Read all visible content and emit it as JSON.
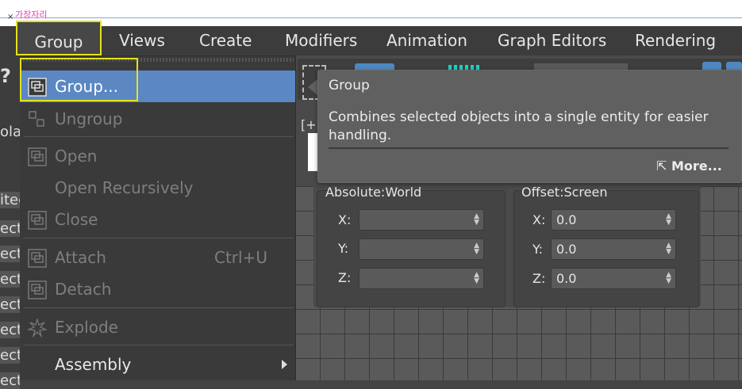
{
  "annotation": {
    "korean_label": "가장자리",
    "close_mark": "×"
  },
  "menubar": {
    "items": [
      {
        "label": "Group"
      },
      {
        "label": "Views"
      },
      {
        "label": "Create"
      },
      {
        "label": "Modifiers"
      },
      {
        "label": "Animation"
      },
      {
        "label": "Graph Editors"
      },
      {
        "label": "Rendering"
      }
    ]
  },
  "left_panel": {
    "fragments": [
      "?",
      "olay",
      "ited",
      "ect",
      "ect",
      "ect",
      "ect",
      "ect",
      "ect",
      "ect"
    ]
  },
  "dropdown": {
    "items": [
      {
        "label": "Group...",
        "state": "selected",
        "icon": "group-icon"
      },
      {
        "label": "Ungroup",
        "state": "disabled",
        "icon": "ungroup-icon"
      },
      {
        "label": "Open",
        "state": "disabled",
        "icon": "open-group-icon"
      },
      {
        "label": "Open Recursively",
        "state": "disabled",
        "icon": ""
      },
      {
        "label": "Close",
        "state": "disabled",
        "icon": "close-group-icon"
      },
      {
        "label": "Attach",
        "shortcut": "Ctrl+U",
        "state": "disabled",
        "icon": "attach-icon"
      },
      {
        "label": "Detach",
        "state": "disabled",
        "icon": "detach-icon"
      },
      {
        "label": "Explode",
        "state": "disabled",
        "icon": "explode-icon"
      },
      {
        "label": "Assembly",
        "state": "enabled",
        "icon": "",
        "submenu": true
      }
    ]
  },
  "tooltip": {
    "title": "Group",
    "description": "Combines selected objects into a single entity for easier handling.",
    "more_label": "More..."
  },
  "viewport": {
    "label_fragment": "[+"
  },
  "coordinates": {
    "absolute": {
      "title": "Absolute:World",
      "x_label": "X:",
      "y_label": "Y:",
      "z_label": "Z:",
      "x_value": "",
      "y_value": "",
      "z_value": ""
    },
    "offset": {
      "title": "Offset:Screen",
      "x_label": "X:",
      "y_label": "Y:",
      "z_label": "Z:",
      "x_value": "0.0",
      "y_value": "0.0",
      "z_value": "0.0"
    }
  },
  "colors": {
    "highlight_border": "#e4e21a",
    "selection_blue": "#5b87c3",
    "annotation_pink": "#e83bb4"
  }
}
